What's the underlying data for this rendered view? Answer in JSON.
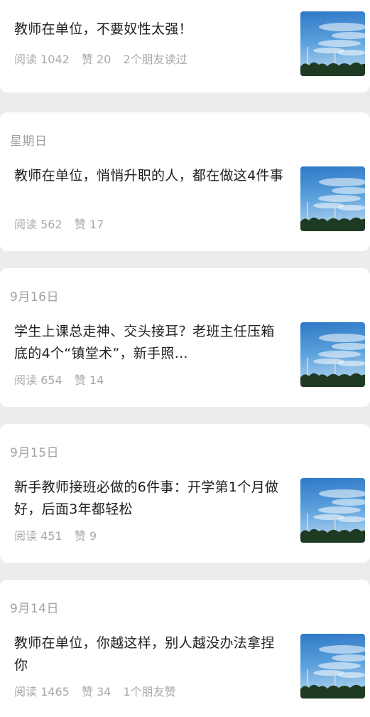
{
  "feed": {
    "articles": [
      {
        "date": "",
        "title": "教师在单位，不要奴性太强！",
        "read": "阅读 1042",
        "likes": "赞 20",
        "social": "2个朋友读过",
        "thumbnail": "sky-with-trees-image"
      },
      {
        "date": "星期日",
        "title": "教师在单位，悄悄升职的人，都在做这4件事",
        "read": "阅读 562",
        "likes": "赞 17",
        "social": "",
        "thumbnail": "sky-with-trees-image"
      },
      {
        "date": "9月16日",
        "title": "学生上课总走神、交头接耳？老班主任压箱底的4个“镇堂术”，新手照…",
        "read": "阅读 654",
        "likes": "赞 14",
        "social": "",
        "thumbnail": "sky-with-trees-image"
      },
      {
        "date": "9月15日",
        "title": "新手教师接班必做的6件事：开学第1个月做好，后面3年都轻松",
        "read": "阅读 451",
        "likes": "赞 9",
        "social": "",
        "thumbnail": "sky-with-trees-image"
      },
      {
        "date": "9月14日",
        "title": "教师在单位，你越这样，别人越没办法拿捏你",
        "read": "阅读 1465",
        "likes": "赞 34",
        "social": "1个朋友赞",
        "thumbnail": "sky-with-trees-image"
      }
    ]
  }
}
